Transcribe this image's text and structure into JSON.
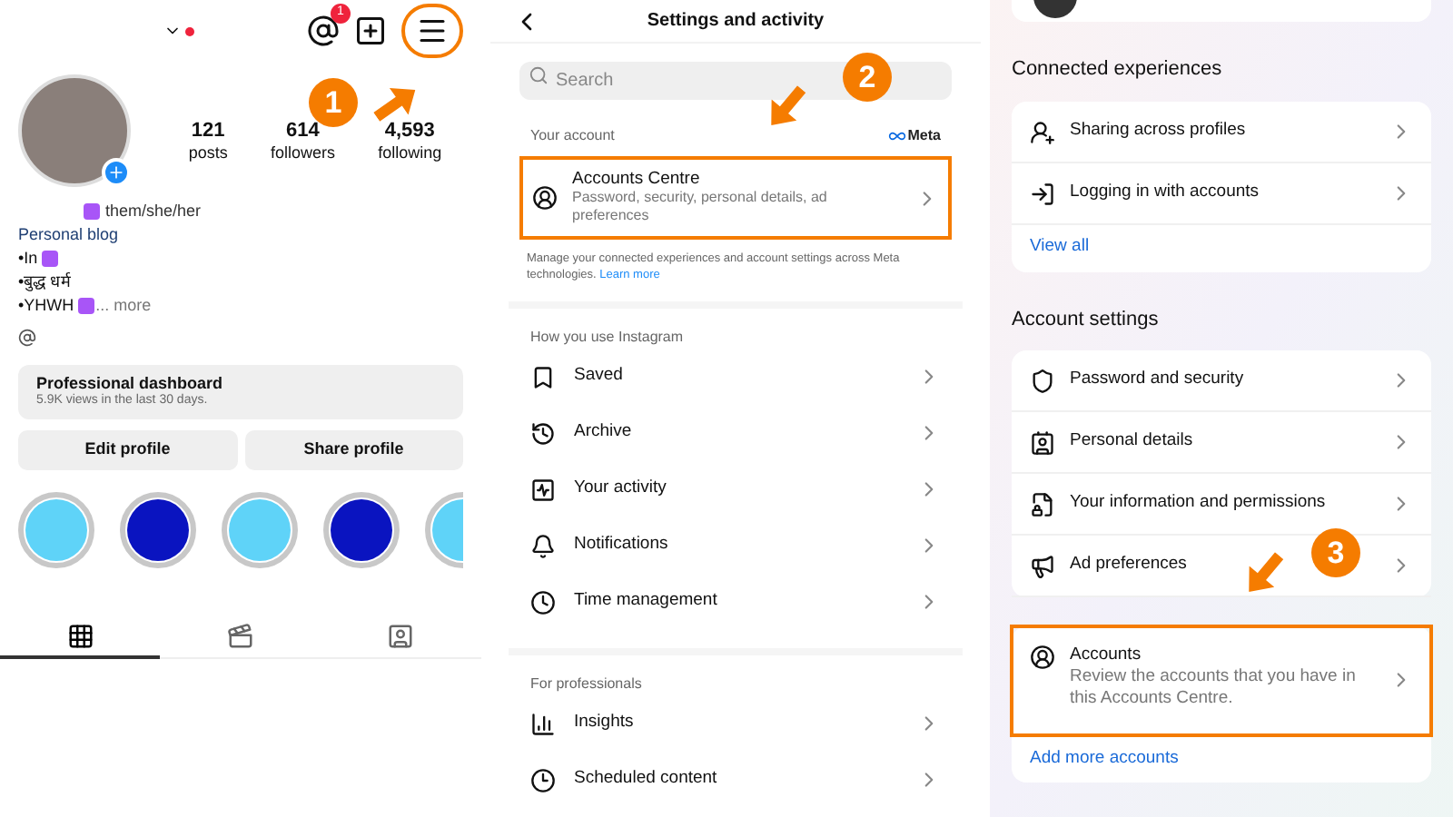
{
  "profile": {
    "menu_highlighted": true,
    "threads_badge": "1",
    "stats": [
      {
        "value": "121",
        "label": "posts"
      },
      {
        "value": "614",
        "label": "followers"
      },
      {
        "value": "4,593",
        "label": "following"
      }
    ],
    "pronouns": "them/she/her",
    "category": "Personal blog",
    "bio_lines": [
      {
        "text": "•In",
        "emoji": true
      },
      {
        "text": "•बुद्ध धर्म",
        "emoji": false
      },
      {
        "text": "•YHWH",
        "emoji": true
      }
    ],
    "more": "... more",
    "dashboard": {
      "title": "Professional dashboard",
      "subtitle": "5.9K views in the last 30 days."
    },
    "buttons": [
      "Edit profile",
      "Share profile"
    ],
    "highlights": [
      {
        "color": "#5fd3f8"
      },
      {
        "color": "#0a14c0"
      },
      {
        "color": "#5fd3f8"
      },
      {
        "color": "#0a14c0"
      },
      {
        "color": "#5fd3f8"
      }
    ],
    "tabs": [
      {
        "selected": true
      },
      {
        "selected": false
      },
      {
        "selected": false
      }
    ]
  },
  "settings": {
    "title": "Settings and activity",
    "search": {
      "placeholder": "Search"
    },
    "your_account": {
      "heading": "Your account",
      "brand": "Meta",
      "item": {
        "title": "Accounts Centre",
        "subtitle": "Password, security, personal details, ad preferences",
        "highlighted": true
      },
      "note": "Manage your connected experiences and account settings across Meta technologies.",
      "link": "Learn more"
    },
    "sections": [
      {
        "heading": "How you use Instagram",
        "items": [
          "Saved",
          "Archive",
          "Your activity",
          "Notifications",
          "Time management"
        ]
      },
      {
        "heading": "For professionals",
        "items": [
          "Insights",
          "Scheduled content"
        ]
      }
    ]
  },
  "accounts_centre": {
    "sections": [
      {
        "heading": "Connected experiences",
        "items": [
          {
            "title": "Sharing across profiles",
            "highlighted": false
          },
          {
            "title": "Logging in with accounts",
            "highlighted": false
          }
        ],
        "link": "View all"
      },
      {
        "heading": "Account settings",
        "items": [
          {
            "title": "Password and security",
            "highlighted": false
          },
          {
            "title": "Personal details",
            "highlighted": false
          },
          {
            "title": "Your information and permissions",
            "highlighted": false
          },
          {
            "title": "Ad preferences",
            "highlighted": false
          }
        ]
      },
      {
        "items": [
          {
            "title": "Accounts",
            "subtitle": "Review the accounts that you have in this Accounts Centre.",
            "highlighted": true
          }
        ],
        "link": "Add more accounts"
      }
    ]
  },
  "steps": [
    {
      "label": "1"
    },
    {
      "label": "2"
    },
    {
      "label": "3"
    }
  ]
}
